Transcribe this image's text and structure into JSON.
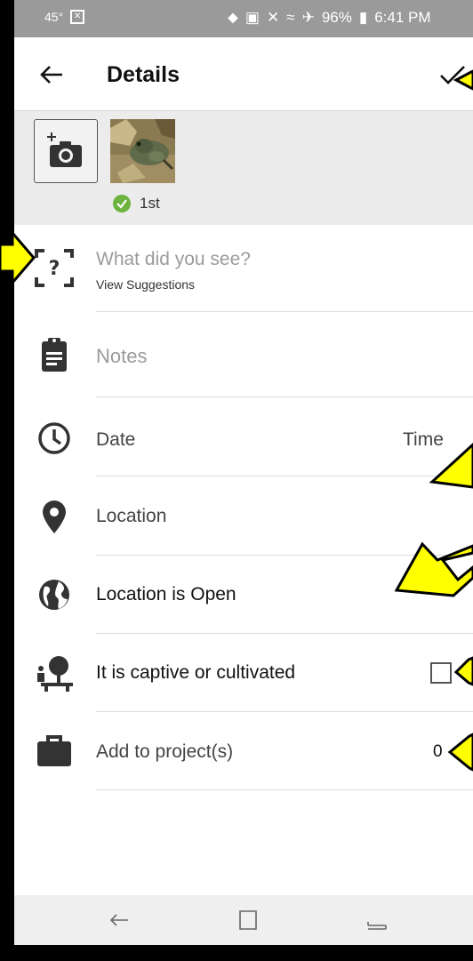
{
  "status_bar": {
    "temperature": "45°",
    "battery": "96%",
    "time": "6:41 PM"
  },
  "toolbar": {
    "title": "Details"
  },
  "photos": {
    "badge_label": "1st"
  },
  "species": {
    "placeholder": "What did you see?",
    "suggestions": "View Suggestions"
  },
  "notes": {
    "placeholder": "Notes"
  },
  "datetime": {
    "date": "Date",
    "time": "Time"
  },
  "location": {
    "label": "Location"
  },
  "geoprivacy": {
    "label": "Location is Open"
  },
  "captive": {
    "label": "It is captive or cultivated",
    "checked": false
  },
  "projects": {
    "label": "Add to project(s)",
    "count": "0"
  },
  "colors": {
    "annotation_arrow": "#ffff00",
    "check_ok": "#6db33f",
    "photo_strip": "#ececec"
  }
}
